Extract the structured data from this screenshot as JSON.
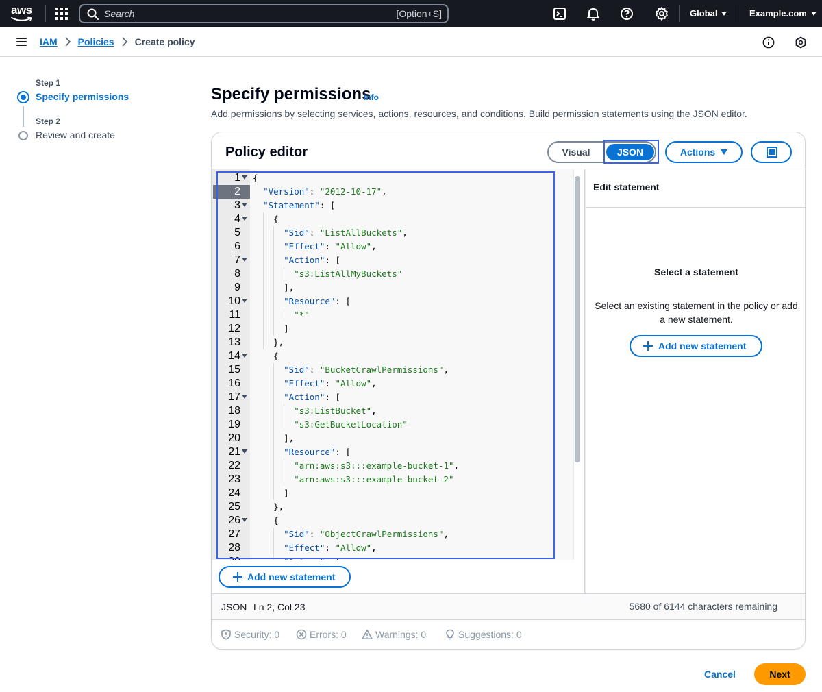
{
  "topnav": {
    "logo_text": "aws",
    "search_placeholder": "Search",
    "search_shortcut": "[Option+S]",
    "region": "Global",
    "account": "Example.com"
  },
  "breadcrumb": {
    "items": [
      "IAM",
      "Policies"
    ],
    "current": "Create policy"
  },
  "steps": [
    {
      "label": "Step 1",
      "title": "Specify permissions",
      "state": "current"
    },
    {
      "label": "Step 2",
      "title": "Review and create",
      "state": "upcoming"
    }
  ],
  "header": {
    "title": "Specify permissions",
    "info": "Info",
    "description": "Add permissions by selecting services, actions, resources, and conditions. Build permission statements using the JSON editor."
  },
  "editor": {
    "title": "Policy editor",
    "mode_visual": "Visual",
    "mode_json": "JSON",
    "actions_label": "Actions",
    "active_line": 2,
    "lines": [
      "{",
      "  \"Version\": \"2012-10-17\",",
      "  \"Statement\": [",
      "    {",
      "      \"Sid\": \"ListAllBuckets\",",
      "      \"Effect\": \"Allow\",",
      "      \"Action\": [",
      "        \"s3:ListAllMyBuckets\"",
      "      ],",
      "      \"Resource\": [",
      "        \"*\"",
      "      ]",
      "    },",
      "    {",
      "      \"Sid\": \"BucketCrawlPermissions\",",
      "      \"Effect\": \"Allow\",",
      "      \"Action\": [",
      "        \"s3:ListBucket\",",
      "        \"s3:GetBucketLocation\"",
      "      ],",
      "      \"Resource\": [",
      "        \"arn:aws:s3:::example-bucket-1\",",
      "        \"arn:aws:s3:::example-bucket-2\"",
      "      ]",
      "    },",
      "    {",
      "      \"Sid\": \"ObjectCrawlPermissions\",",
      "      \"Effect\": \"Allow\",",
      "      \"Action\": ["
    ],
    "fold_lines": [
      1,
      3,
      4,
      7,
      10,
      14,
      17,
      21,
      26
    ],
    "add_statement": "Add new statement"
  },
  "side_panel": {
    "heading": "Edit statement",
    "title": "Select a statement",
    "description": "Select an existing statement in the policy or add a new statement.",
    "add_statement": "Add new statement"
  },
  "status_bar": {
    "language": "JSON",
    "position": "Ln 2, Col 23",
    "remaining": "5680 of 6144 characters remaining"
  },
  "lint": {
    "security": "Security: 0",
    "errors": "Errors: 0",
    "warnings": "Warnings: 0",
    "suggestions": "Suggestions: 0"
  },
  "footer": {
    "cancel": "Cancel",
    "next": "Next"
  },
  "colors": {
    "accent": "#0972d3",
    "primary_button": "#ff9900",
    "nav_bg": "#16191f",
    "focus_ring": "#3b63e5"
  }
}
